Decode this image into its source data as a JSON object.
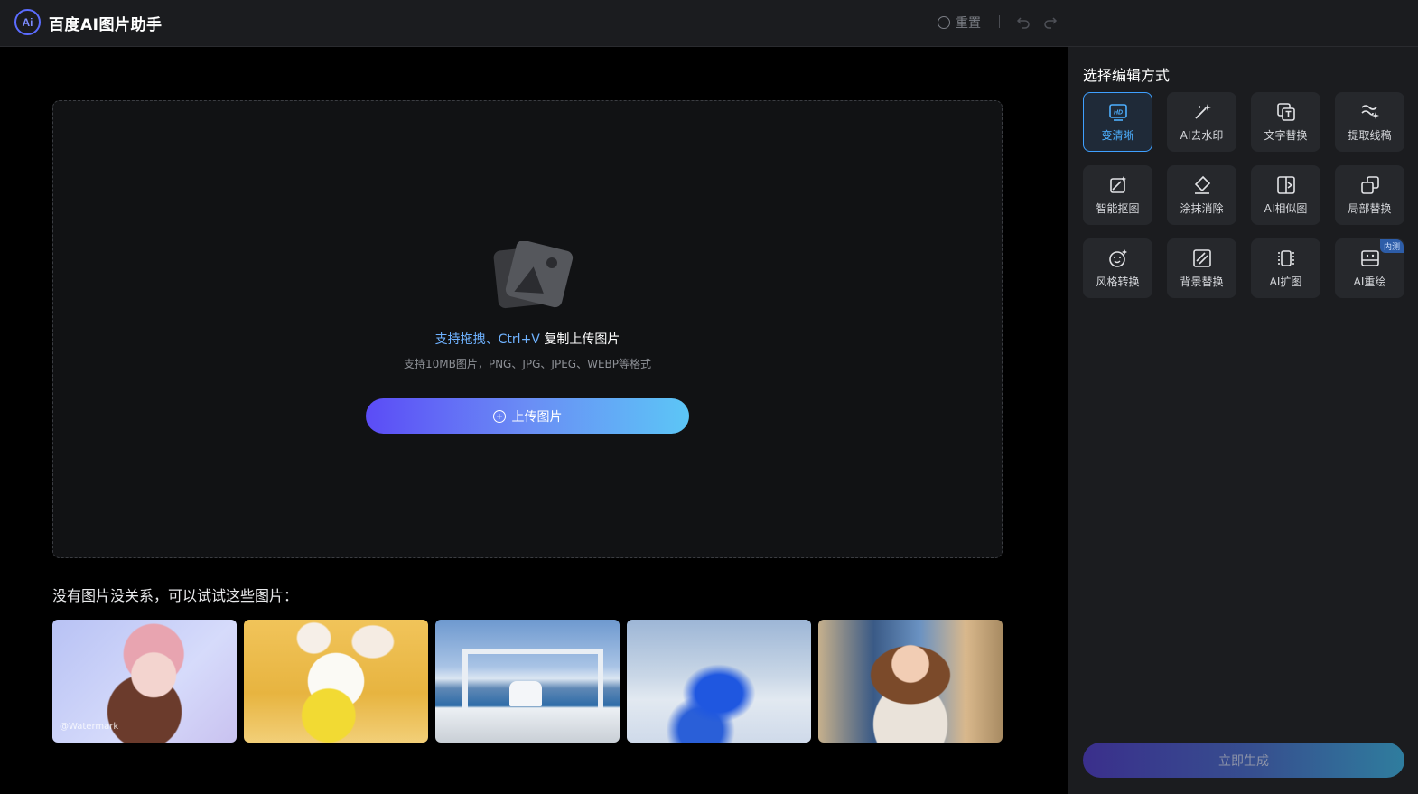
{
  "header": {
    "logo_text": "Ai",
    "title": "百度AI图片助手",
    "reset_label": "重置"
  },
  "upload": {
    "hint_accent": "支持拖拽、Ctrl+V",
    "hint_rest": " 复制上传图片",
    "sub": "支持10MB图片，PNG、JPG、JPEG、WEBP等格式",
    "button_label": "上传图片"
  },
  "samples": {
    "title": "没有图片没关系，可以试试这些图片：",
    "watermark": "@Watermark"
  },
  "panel": {
    "title": "选择编辑方式",
    "tools": [
      {
        "label": "变清晰",
        "icon": "hd-icon",
        "active": true
      },
      {
        "label": "AI去水印",
        "icon": "magic-wand-icon"
      },
      {
        "label": "文字替换",
        "icon": "text-replace-icon"
      },
      {
        "label": "提取线稿",
        "icon": "line-art-icon"
      },
      {
        "label": "智能抠图",
        "icon": "cutout-icon"
      },
      {
        "label": "涂抹消除",
        "icon": "eraser-icon"
      },
      {
        "label": "AI相似图",
        "icon": "similar-image-icon"
      },
      {
        "label": "局部替换",
        "icon": "partial-replace-icon"
      },
      {
        "label": "风格转换",
        "icon": "style-transfer-icon"
      },
      {
        "label": "背景替换",
        "icon": "background-replace-icon"
      },
      {
        "label": "AI扩图",
        "icon": "expand-image-icon"
      },
      {
        "label": "AI重绘",
        "icon": "redraw-icon",
        "badge": "内测"
      }
    ],
    "generate_label": "立即生成"
  },
  "colors": {
    "accent": "#4db0ff",
    "upload_gradient_start": "#5b4cf6",
    "upload_gradient_end": "#5cc6f6"
  }
}
